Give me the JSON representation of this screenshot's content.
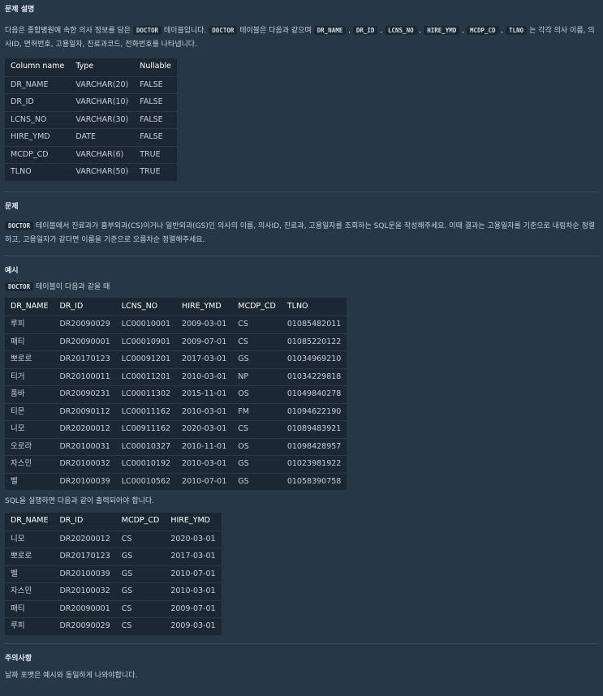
{
  "sections": {
    "desc_title": "문제 설명",
    "problem_title": "문제",
    "example_title": "예시",
    "note_title": "주의사항"
  },
  "desc": {
    "t1": "다음은 종합병원에 속한 의사 정보를 담은 ",
    "c1": "DOCTOR",
    "t2": " 테이블입니다. ",
    "c2": "DOCTOR",
    "t3": " 테이블은 다음과 같으며 ",
    "cols": [
      "DR_NAME",
      "DR_ID",
      "LCNS_NO",
      "HIRE_YMD",
      "MCDP_CD",
      "TLNO"
    ],
    "t4": " 는 각각 의사 이름, 의사ID, 면허번호, 고용일자, 진료과코드, 전화번호를 나타냅니다."
  },
  "schema_table": {
    "headers": [
      "Column name",
      "Type",
      "Nullable"
    ],
    "rows": [
      [
        "DR_NAME",
        "VARCHAR(20)",
        "FALSE"
      ],
      [
        "DR_ID",
        "VARCHAR(10)",
        "FALSE"
      ],
      [
        "LCNS_NO",
        "VARCHAR(30)",
        "FALSE"
      ],
      [
        "HIRE_YMD",
        "DATE",
        "FALSE"
      ],
      [
        "MCDP_CD",
        "VARCHAR(6)",
        "TRUE"
      ],
      [
        "TLNO",
        "VARCHAR(50)",
        "TRUE"
      ]
    ]
  },
  "problem": {
    "code": "DOCTOR",
    "text": " 테이블에서 진료과가 흉부외과(CS)이거나 일반외과(GS)인 의사의 이름, 의사ID, 진료과, 고용일자를 조회하는 SQL문을 작성해주세요. 이때 결과는 고용일자를 기준으로 내림차순 정렬하고, 고용일자가 같다면 이름을 기준으로 오름차순 정렬해주세요."
  },
  "example": {
    "code": "DOCTOR",
    "text": " 테이블이 다음과 같을 때",
    "result_text": "SQL을 실행하면 다음과 같이 출력되어야 합니다."
  },
  "data_table": {
    "headers": [
      "DR_NAME",
      "DR_ID",
      "LCNS_NO",
      "HIRE_YMD",
      "MCDP_CD",
      "TLNO"
    ],
    "rows": [
      [
        "루피",
        "DR20090029",
        "LC00010001",
        "2009-03-01",
        "CS",
        "01085482011"
      ],
      [
        "패티",
        "DR20090001",
        "LC00010901",
        "2009-07-01",
        "CS",
        "01085220122"
      ],
      [
        "뽀로로",
        "DR20170123",
        "LC00091201",
        "2017-03-01",
        "GS",
        "01034969210"
      ],
      [
        "티거",
        "DR20100011",
        "LC00011201",
        "2010-03-01",
        "NP",
        "01034229818"
      ],
      [
        "품바",
        "DR20090231",
        "LC00011302",
        "2015-11-01",
        "OS",
        "01049840278"
      ],
      [
        "티몬",
        "DR20090112",
        "LC00011162",
        "2010-03-01",
        "FM",
        "01094622190"
      ],
      [
        "니모",
        "DR20200012",
        "LC00911162",
        "2020-03-01",
        "CS",
        "01089483921"
      ],
      [
        "오로라",
        "DR20100031",
        "LC00010327",
        "2010-11-01",
        "OS",
        "01098428957"
      ],
      [
        "자스민",
        "DR20100032",
        "LC00010192",
        "2010-03-01",
        "GS",
        "01023981922"
      ],
      [
        "벨",
        "DR20100039",
        "LC00010562",
        "2010-07-01",
        "GS",
        "01058390758"
      ]
    ]
  },
  "result_table": {
    "headers": [
      "DR_NAME",
      "DR_ID",
      "MCDP_CD",
      "HIRE_YMD"
    ],
    "rows": [
      [
        "니모",
        "DR20200012",
        "CS",
        "2020-03-01"
      ],
      [
        "뽀로로",
        "DR20170123",
        "GS",
        "2017-03-01"
      ],
      [
        "벨",
        "DR20100039",
        "GS",
        "2010-07-01"
      ],
      [
        "자스민",
        "DR20100032",
        "GS",
        "2010-03-01"
      ],
      [
        "패티",
        "DR20090001",
        "CS",
        "2009-07-01"
      ],
      [
        "루피",
        "DR20090029",
        "CS",
        "2009-03-01"
      ]
    ]
  },
  "note": {
    "text": "날짜 포맷은 예시와 동일하게 나와야합니다."
  }
}
